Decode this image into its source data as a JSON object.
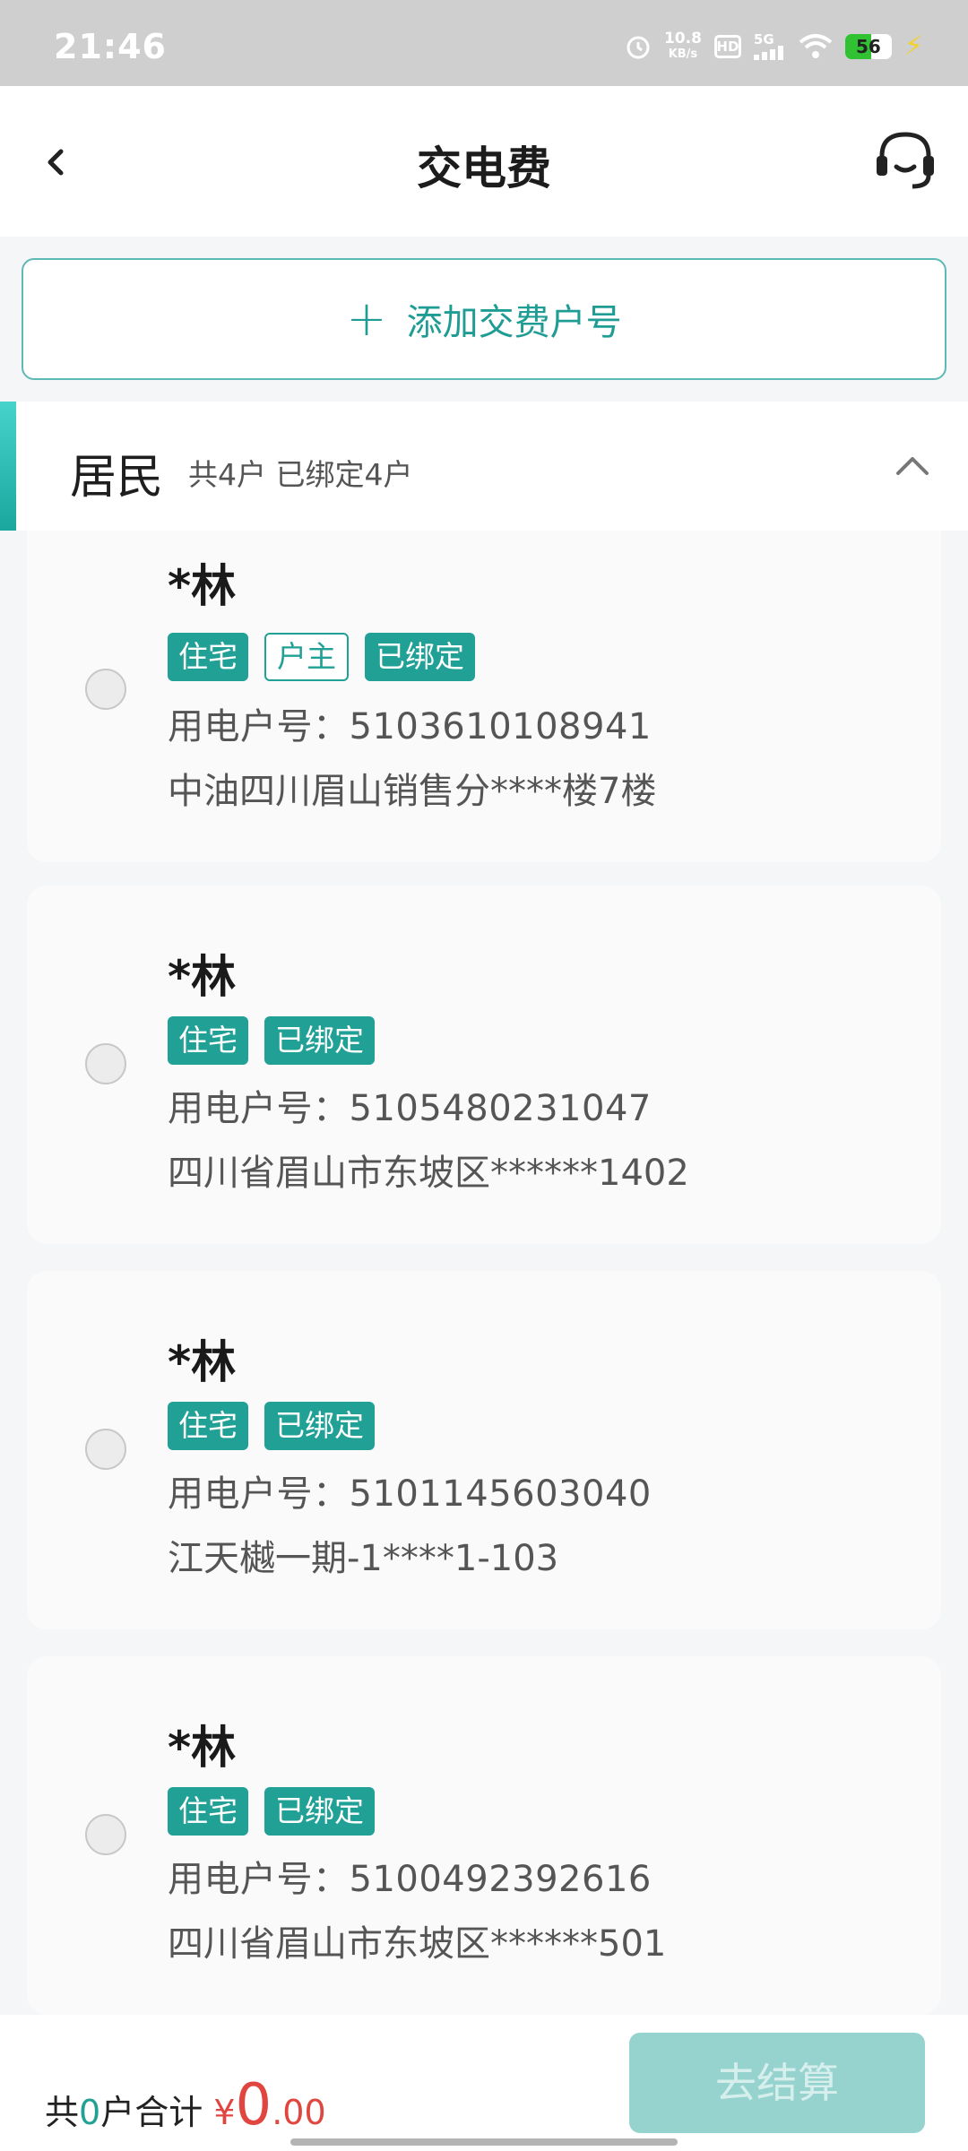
{
  "status": {
    "time": "21:46",
    "speed_value": "10.8",
    "speed_unit": "KB/s",
    "hd": "HD",
    "network": "5G",
    "battery": "56"
  },
  "header": {
    "title": "交电费"
  },
  "add_account": {
    "plus": "+",
    "label": "添加交费户号"
  },
  "group": {
    "title": "居民",
    "summary": "共4户 已绑定4户"
  },
  "accounts": [
    {
      "name": "*林",
      "tags": [
        "住宅",
        "户主",
        "已绑定"
      ],
      "account": "用电户号：5103610108941",
      "address": "中油四川眉山销售分****楼7楼"
    },
    {
      "name": "*林",
      "tags": [
        "住宅",
        "已绑定"
      ],
      "account": "用电户号：5105480231047",
      "address": "四川省眉山市东坡区******1402"
    },
    {
      "name": "*林",
      "tags": [
        "住宅",
        "已绑定"
      ],
      "account": "用电户号：5101145603040",
      "address": "江天樾一期-1****1-103"
    },
    {
      "name": "*林",
      "tags": [
        "住宅",
        "已绑定"
      ],
      "account": "用电户号：5100492392616",
      "address": "四川省眉山市东坡区******501"
    }
  ],
  "footer": {
    "prefix": "共",
    "count": "0",
    "middle": "户合计",
    "currency": "¥",
    "amount_int": "0",
    "amount_dec": ".00",
    "checkout_label": "去结算"
  },
  "colors": {
    "accent": "#21a096",
    "price": "#e0463f",
    "checkout_disabled": "#96d3cf"
  }
}
